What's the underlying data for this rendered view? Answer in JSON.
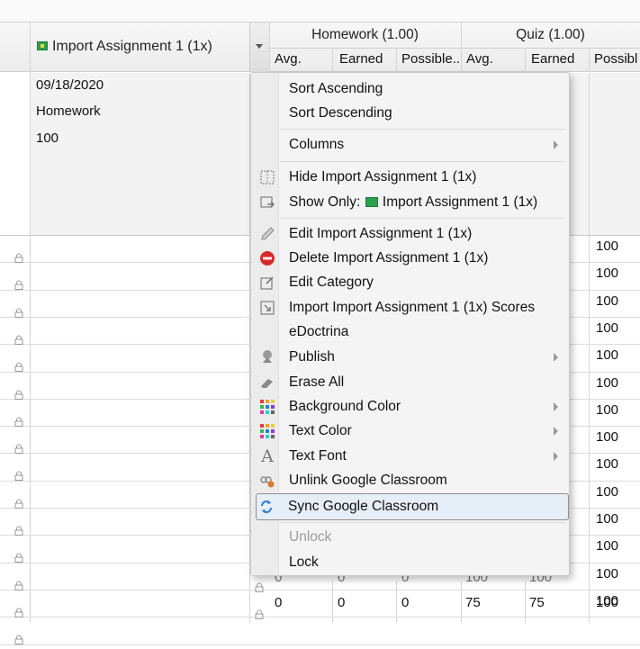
{
  "grid": {
    "column_header_label": "Import Assignment 1 (1x)",
    "groups": [
      {
        "label": "Homework (1.00)"
      },
      {
        "label": "Quiz (1.00)"
      }
    ],
    "subheaders": [
      "Avg.",
      "Earned",
      "Possible..",
      "Avg.",
      "Earned",
      "Possibl"
    ],
    "assignment_info": {
      "date": "09/18/2020",
      "category": "Homework",
      "points": "100"
    },
    "right_column_values": [
      "100",
      "100",
      "100",
      "100",
      "100",
      "100",
      "100",
      "100",
      "100",
      "100",
      "100",
      "100",
      "100",
      "100"
    ],
    "bottom_row": [
      "0",
      "0",
      "0",
      "75",
      "75",
      "100"
    ],
    "partial_row": [
      "0",
      "0",
      "0",
      "100",
      "100"
    ]
  },
  "menu": {
    "items": [
      {
        "label": "Sort Ascending",
        "icon": ""
      },
      {
        "label": "Sort Descending",
        "icon": ""
      },
      {
        "label": "Columns",
        "icon": "",
        "submenu": true
      },
      {
        "label": "Hide Import Assignment 1 (1x)",
        "icon": "hide-column-icon"
      },
      {
        "label": "Show Only:",
        "label2": "Import Assignment 1 (1x)",
        "icon": "show-only-icon"
      },
      {
        "label": "Edit Import Assignment 1 (1x)",
        "icon": "pencil-icon"
      },
      {
        "label": "Delete Import Assignment 1 (1x)",
        "icon": "delete-icon"
      },
      {
        "label": "Edit Category",
        "icon": "edit-category-icon"
      },
      {
        "label": "Import Import Assignment 1 (1x) Scores",
        "icon": "import-scores-icon"
      },
      {
        "label": "eDoctrina",
        "icon": ""
      },
      {
        "label": "Publish",
        "icon": "publish-icon",
        "submenu": true
      },
      {
        "label": "Erase All",
        "icon": "eraser-icon"
      },
      {
        "label": "Background Color",
        "icon": "color-grid-icon",
        "submenu": true
      },
      {
        "label": "Text Color",
        "icon": "color-grid-icon",
        "submenu": true
      },
      {
        "label": "Text Font",
        "icon": "font-icon",
        "submenu": true
      },
      {
        "label": "Unlink Google Classroom",
        "icon": "unlink-icon"
      },
      {
        "label": "Sync Google Classroom",
        "icon": "sync-icon",
        "selected": true
      },
      {
        "label": "Unlock",
        "icon": "",
        "disabled": true
      },
      {
        "label": "Lock",
        "icon": ""
      }
    ]
  },
  "colors": {
    "accent": "#2b7bd6",
    "delete_red": "#d62b2b",
    "classroom_green": "#27a24a"
  }
}
